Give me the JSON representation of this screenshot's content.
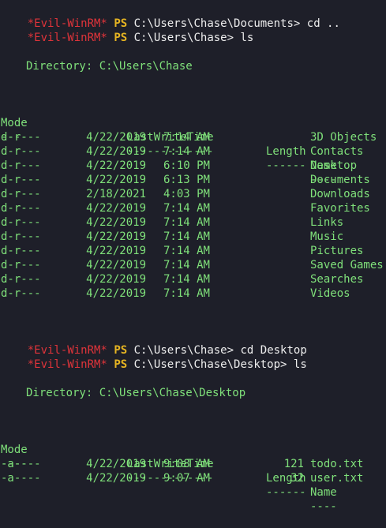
{
  "prompt": {
    "tag": "*Evil-WinRM*",
    "ps": "PS",
    "space": " "
  },
  "history": [
    {
      "path": "C:\\Users\\Chase\\Documents>",
      "command": "cd .."
    },
    {
      "path": "C:\\Users\\Chase>",
      "command": "ls"
    },
    {
      "path": "C:\\Users\\Chase>",
      "command": "cd Desktop"
    },
    {
      "path": "C:\\Users\\Chase\\Desktop>",
      "command": "ls"
    }
  ],
  "listing1": {
    "directory_line": "Directory: C:\\Users\\Chase",
    "headers": {
      "mode": "Mode",
      "lastwritetime": "LastWriteTime",
      "length": "Length",
      "name": "Name"
    },
    "underlines": {
      "mode": "----",
      "lastwritetime": "-------------",
      "length": "------",
      "name": "----"
    },
    "rows": [
      {
        "mode": "d-r---",
        "date": "4/22/2019",
        "time": "7:14 AM",
        "length": "",
        "name": "3D Objects"
      },
      {
        "mode": "d-r---",
        "date": "4/22/2019",
        "time": "7:14 AM",
        "length": "",
        "name": "Contacts"
      },
      {
        "mode": "d-r---",
        "date": "4/22/2019",
        "time": "6:10 PM",
        "length": "",
        "name": "Desktop"
      },
      {
        "mode": "d-r---",
        "date": "4/22/2019",
        "time": "6:13 PM",
        "length": "",
        "name": "Documents"
      },
      {
        "mode": "d-r---",
        "date": "2/18/2021",
        "time": "4:03 PM",
        "length": "",
        "name": "Downloads"
      },
      {
        "mode": "d-r---",
        "date": "4/22/2019",
        "time": "7:14 AM",
        "length": "",
        "name": "Favorites"
      },
      {
        "mode": "d-r---",
        "date": "4/22/2019",
        "time": "7:14 AM",
        "length": "",
        "name": "Links"
      },
      {
        "mode": "d-r---",
        "date": "4/22/2019",
        "time": "7:14 AM",
        "length": "",
        "name": "Music"
      },
      {
        "mode": "d-r---",
        "date": "4/22/2019",
        "time": "7:14 AM",
        "length": "",
        "name": "Pictures"
      },
      {
        "mode": "d-r---",
        "date": "4/22/2019",
        "time": "7:14 AM",
        "length": "",
        "name": "Saved Games"
      },
      {
        "mode": "d-r---",
        "date": "4/22/2019",
        "time": "7:14 AM",
        "length": "",
        "name": "Searches"
      },
      {
        "mode": "d-r---",
        "date": "4/22/2019",
        "time": "7:14 AM",
        "length": "",
        "name": "Videos"
      }
    ]
  },
  "listing2": {
    "directory_line": "Directory: C:\\Users\\Chase\\Desktop",
    "headers": {
      "mode": "Mode",
      "lastwritetime": "LastWriteTime",
      "length": "Length",
      "name": "Name"
    },
    "underlines": {
      "mode": "----",
      "lastwritetime": "-------------",
      "length": "------",
      "name": "----"
    },
    "rows": [
      {
        "mode": "-a----",
        "date": "4/22/2019",
        "time": "9:08 AM",
        "length": "121",
        "name": "todo.txt"
      },
      {
        "mode": "-a----",
        "date": "4/22/2019",
        "time": "9:07 AM",
        "length": "32",
        "name": "user.txt"
      }
    ]
  },
  "colors": {
    "background": "#1e1f29",
    "evil_tag": "#e0343a",
    "ps_label": "#e6b422",
    "text": "#eeeeee",
    "output_green": "#7fe07a"
  }
}
